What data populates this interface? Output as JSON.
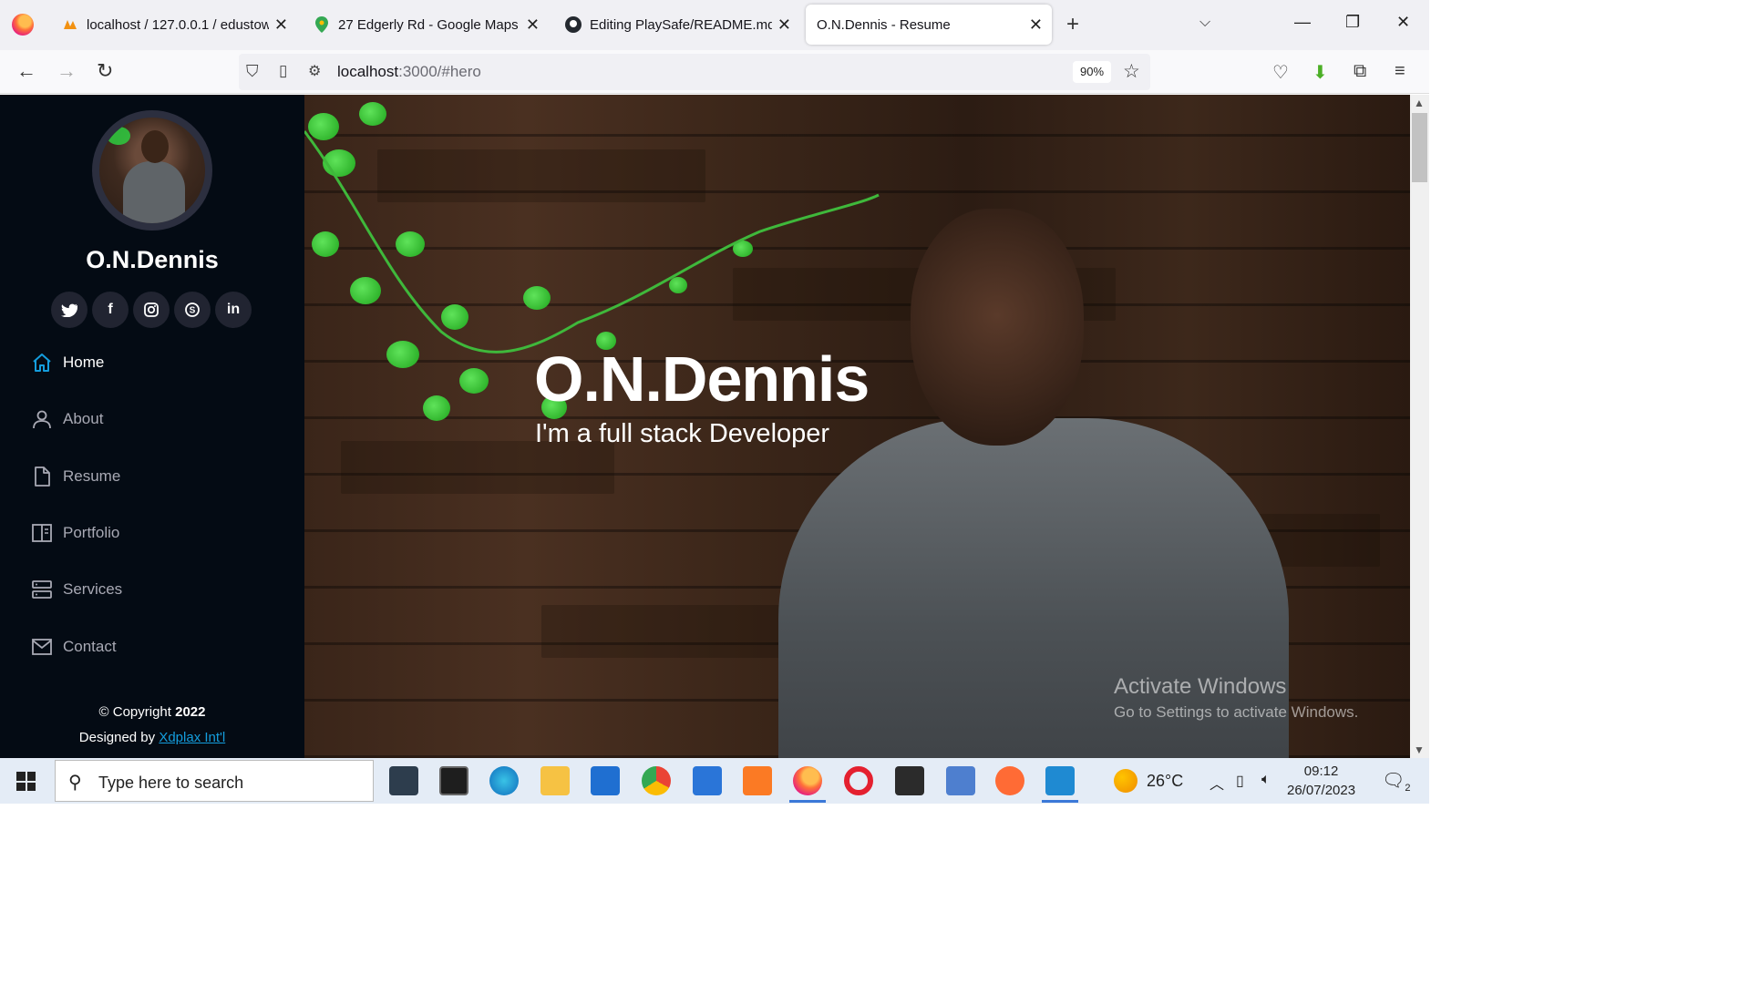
{
  "browser": {
    "tabs": [
      {
        "title": "localhost / 127.0.0.1 / edustow",
        "icon": "phpmyadmin-icon"
      },
      {
        "title": "27 Edgerly Rd - Google Maps",
        "icon": "maps-pin-icon"
      },
      {
        "title": "Editing PlaySafe/README.md at",
        "icon": "github-icon"
      },
      {
        "title": "O.N.Dennis - Resume",
        "icon": "page-icon"
      }
    ],
    "url_host": "localhost",
    "url_rest": ":3000/#hero",
    "zoom": "90%"
  },
  "sidebar": {
    "name": "O.N.Dennis",
    "socials": [
      "twitter",
      "facebook",
      "instagram",
      "skype",
      "linkedin"
    ],
    "nav": [
      {
        "label": "Home",
        "icon": "home-icon",
        "active": true
      },
      {
        "label": "About",
        "icon": "person-icon"
      },
      {
        "label": "Resume",
        "icon": "document-icon"
      },
      {
        "label": "Portfolio",
        "icon": "portfolio-icon"
      },
      {
        "label": "Services",
        "icon": "server-icon"
      },
      {
        "label": "Contact",
        "icon": "envelope-icon"
      }
    ],
    "footer": {
      "copyright_prefix": "© Copyright",
      "year": "2022",
      "designed_by": "Designed by",
      "designer": "Xdplax Int'l"
    }
  },
  "hero": {
    "title": "O.N.Dennis",
    "subtitle": "I'm a full stack Developer"
  },
  "watermark": {
    "line1": "Activate Windows",
    "line2": "Go to Settings to activate Windows."
  },
  "taskbar": {
    "search_placeholder": "Type here to search",
    "temperature": "26°C",
    "time": "09:12",
    "date": "26/07/2023",
    "notifications": "2"
  },
  "colors": {
    "sidebar_bg": "#040b14",
    "accent": "#149ddd",
    "social_bg": "#212431"
  }
}
